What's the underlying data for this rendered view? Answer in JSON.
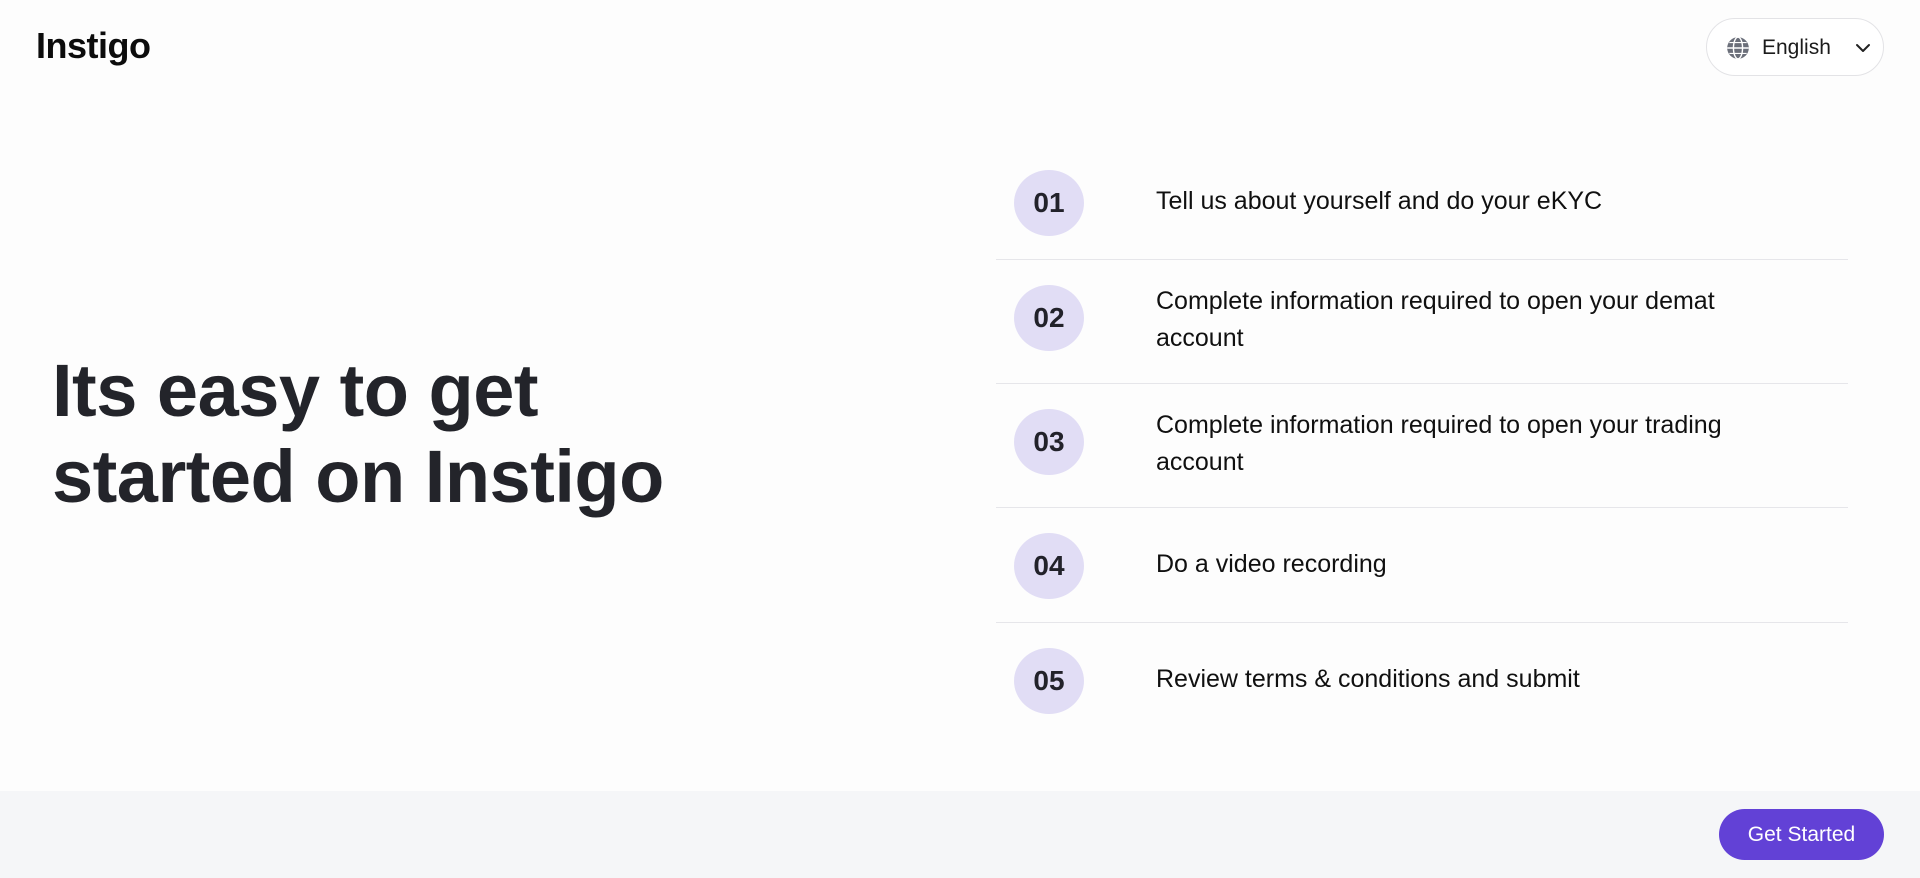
{
  "header": {
    "logo": "Instigo",
    "language": {
      "label": "English",
      "icon": "globe-icon",
      "dropdown_icon": "chevron-down-icon"
    }
  },
  "hero": {
    "line1": "Its easy to get",
    "line2": "started on Instigo"
  },
  "steps": [
    {
      "number": "01",
      "text": "Tell us about yourself and do your eKYC"
    },
    {
      "number": "02",
      "text": "Complete information required to open your demat account"
    },
    {
      "number": "03",
      "text": "Complete information required to open your trading account"
    },
    {
      "number": "04",
      "text": "Do a video recording"
    },
    {
      "number": "05",
      "text": "Review terms & conditions and submit"
    }
  ],
  "footer": {
    "cta_label": "Get Started"
  },
  "colors": {
    "accent": "#6241d6",
    "step_badge_bg": "#e1ddf5",
    "footer_bg": "#f5f6f8"
  }
}
